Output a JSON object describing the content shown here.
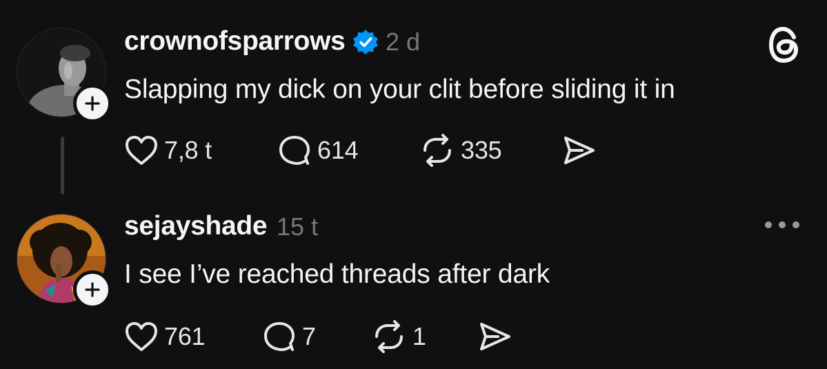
{
  "posts": [
    {
      "username": "crownofsparrows",
      "verified": true,
      "time": "2 d",
      "text": "Slapping my dick on your clit before sliding it in",
      "likes": "7,8 t",
      "replies": "614",
      "reposts": "335"
    },
    {
      "username": "sejayshade",
      "verified": false,
      "time": "15 t",
      "text": "I see I’ve reached threads after dark",
      "likes": "761",
      "replies": "7",
      "reposts": "1"
    }
  ],
  "icons": {
    "logo": "threads-logo-icon",
    "verified": "verified-badge-icon",
    "like": "heart-icon",
    "reply": "comment-bubble-icon",
    "repost": "repost-icon",
    "share": "send-icon",
    "follow": "plus-icon",
    "more": "more-options-icon"
  },
  "colors": {
    "background": "#101010",
    "text": "#f3f5f7",
    "muted": "#777777",
    "verified": "#0095f6"
  }
}
